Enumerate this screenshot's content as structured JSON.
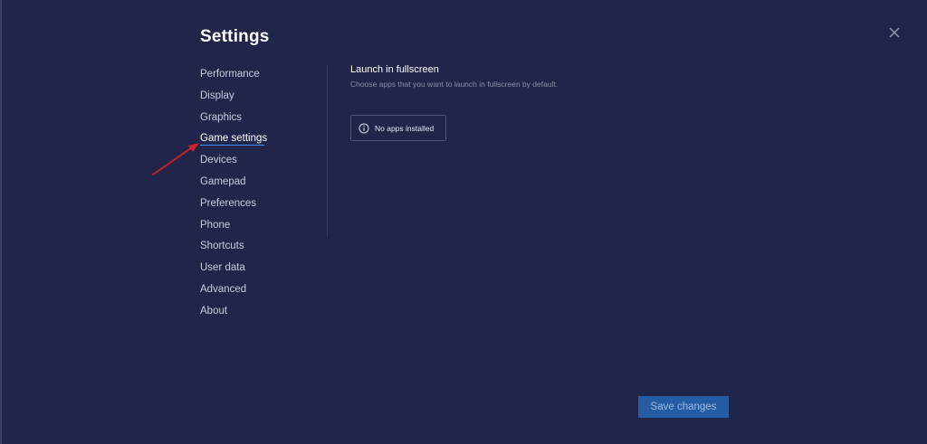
{
  "title": "Settings",
  "close_icon": "close-icon",
  "nav": {
    "items": [
      {
        "label": "Performance"
      },
      {
        "label": "Display"
      },
      {
        "label": "Graphics"
      },
      {
        "label": "Game settings",
        "active": true
      },
      {
        "label": "Devices"
      },
      {
        "label": "Gamepad"
      },
      {
        "label": "Preferences"
      },
      {
        "label": "Phone"
      },
      {
        "label": "Shortcuts"
      },
      {
        "label": "User data"
      },
      {
        "label": "Advanced"
      },
      {
        "label": "About"
      }
    ]
  },
  "content": {
    "section_title": "Launch in fullscreen",
    "section_desc": "Choose apps that you want to launch in fullscreen by default.",
    "empty_message": "No apps installed",
    "empty_icon": "info-icon"
  },
  "footer": {
    "save_label": "Save changes"
  },
  "colors": {
    "background": "#21254a",
    "accent": "#4d8ef0",
    "save_button": "#245ca6",
    "annotation_arrow": "#d11f2a"
  }
}
